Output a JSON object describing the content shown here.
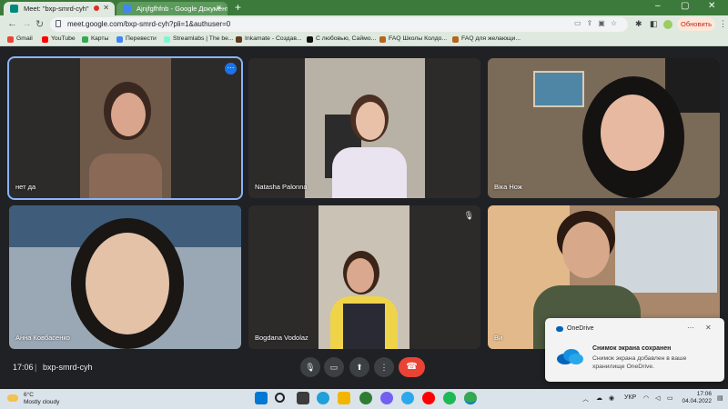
{
  "browser": {
    "tabs": [
      {
        "title": "Meet: \"bxp-smrd-cyh\"",
        "active": true,
        "favicon_color": "#00897b"
      },
      {
        "title": "Ajnjfgfhfnb - Google Документи",
        "active": false,
        "favicon_color": "#4285f4"
      }
    ],
    "url": "meet.google.com/bxp-smrd-cyh?pli=1&authuser=0",
    "update_label": "Обновить",
    "bookmarks": [
      {
        "label": "Gmail",
        "color": "#ea4335"
      },
      {
        "label": "YouTube",
        "color": "#ff0000"
      },
      {
        "label": "Карты",
        "color": "#34a853"
      },
      {
        "label": "Перевести",
        "color": "#4285f4"
      },
      {
        "label": "Streamlabs | The be...",
        "color": "#80f5d2"
      },
      {
        "label": "Inkamate - Создав...",
        "color": "#5f3a1f"
      },
      {
        "label": "С любовью, Саймо...",
        "color": "#111111"
      },
      {
        "label": "FAQ Школы Колдо...",
        "color": "#b5651d"
      },
      {
        "label": "FAQ для желающи...",
        "color": "#b5651d"
      }
    ]
  },
  "meet": {
    "participants": [
      {
        "name": "нет да",
        "bg": "#6f5a4a",
        "skin": "#d9a58c",
        "hair": "#3a2820",
        "speaking": true
      },
      {
        "name": "Natasha Palonna",
        "bg": "#b8b2a6",
        "skin": "#e8c1a8",
        "hair": "#4a2f22",
        "speaking": false
      },
      {
        "name": "Віка Нож",
        "bg": "#7a6a58",
        "skin": "#e6b9a0",
        "hair": "#151212",
        "speaking": false
      },
      {
        "name": "Анна Ковбасенко",
        "bg": "#9aa8b5",
        "skin": "#e3c2a8",
        "hair": "#1a1614",
        "speaking": false
      },
      {
        "name": "Bogdana Vodolaz",
        "bg": "#c9c2b5",
        "skin": "#d9a88e",
        "hair": "#3b2418",
        "speaking": false,
        "muted": true
      },
      {
        "name": "Ви",
        "bg": "#a8876a",
        "skin": "#d8a88a",
        "hair": "#2a1a12",
        "speaking": false
      }
    ],
    "time": "17:06",
    "meeting_code": "bxp-smrd-cyh",
    "controls": {
      "mic": "mic-icon",
      "camera": "camera-icon",
      "present": "present-icon",
      "more": "more-icon",
      "hangup": "hangup-icon"
    }
  },
  "toast": {
    "app": "OneDrive",
    "title": "Снимок экрана сохранен",
    "body": "Снимок экрана добавлен в ваше хранилище OneDrive."
  },
  "taskbar": {
    "weather_temp": "6°C",
    "weather_cond": "Mostly cloudy",
    "lang": "УКР",
    "time": "17:06",
    "date": "04.04.2022",
    "apps": [
      {
        "name": "start",
        "color": "#0078d4"
      },
      {
        "name": "search",
        "color": "#202124"
      },
      {
        "name": "task-view",
        "color": "#3c3c3c"
      },
      {
        "name": "edge",
        "color": "#1fa0d8"
      },
      {
        "name": "explorer",
        "color": "#f2b600"
      },
      {
        "name": "app-green",
        "color": "#2e7d32"
      },
      {
        "name": "viber",
        "color": "#7360f2"
      },
      {
        "name": "telegram",
        "color": "#29a9eb"
      },
      {
        "name": "youtube",
        "color": "#ff0000"
      },
      {
        "name": "spotify",
        "color": "#1db954"
      },
      {
        "name": "chrome",
        "color": "#34a853"
      }
    ]
  }
}
